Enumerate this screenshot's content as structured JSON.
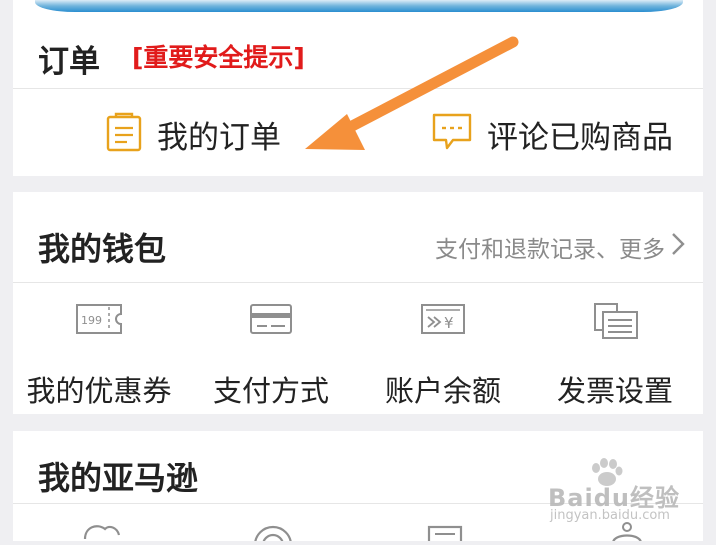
{
  "orders": {
    "title": "订单",
    "warning": "[重要安全提示]",
    "items": [
      {
        "label": "我的订单",
        "icon": "clipboard-icon"
      },
      {
        "label": "评论已购商品",
        "icon": "comment-icon"
      }
    ]
  },
  "wallet": {
    "title": "我的钱包",
    "more_link": "支付和退款记录、更多",
    "items": [
      {
        "label": "我的优惠券",
        "icon": "coupon-icon",
        "icon_text": "199"
      },
      {
        "label": "支付方式",
        "icon": "credit-card-icon"
      },
      {
        "label": "账户余额",
        "icon": "balance-icon",
        "icon_text": "¥"
      },
      {
        "label": "发票设置",
        "icon": "invoice-icon"
      }
    ]
  },
  "amazon": {
    "title": "我的亚马逊"
  },
  "watermark": {
    "main": "Baidu经验",
    "sub": "jingyan.baidu.com"
  },
  "colors": {
    "accent_orange": "#e8a21c",
    "warning_red": "#e11b1b",
    "annotation_arrow": "#f5903a",
    "icon_gray": "#8f8f8f"
  }
}
